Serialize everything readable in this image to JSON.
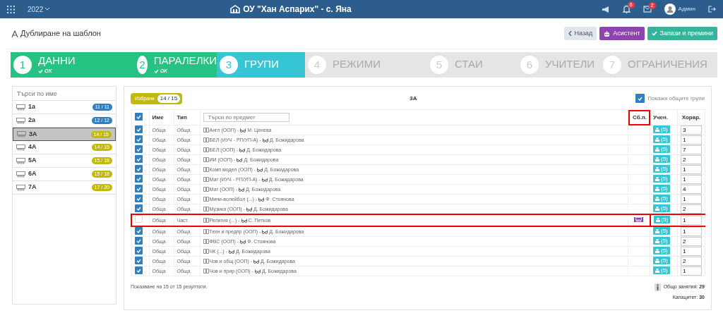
{
  "topbar": {
    "year": "2022",
    "school": "ОУ \"Хан Аспарих\" - с. Яна",
    "notifications": "6",
    "messages": "2",
    "user": "Админ"
  },
  "page": {
    "title": "Дублиране на шаблон",
    "buttons": [
      {
        "label": "Назад",
        "kind": "back"
      },
      {
        "label": "Асистент",
        "kind": "assistant"
      },
      {
        "label": "Запази и премини",
        "kind": "save"
      }
    ]
  },
  "steps": [
    {
      "number": "1",
      "label": "ДАННИ",
      "completed": true,
      "selected": false,
      "note": "OK"
    },
    {
      "number": "2",
      "label": "ПАРАЛЕЛКИ",
      "completed": true,
      "selected": false,
      "note": "OK"
    },
    {
      "number": "3",
      "label": "ГРУПИ",
      "completed": false,
      "selected": true
    },
    {
      "number": "4",
      "label": "РЕЖИМИ",
      "completed": false,
      "selected": false
    },
    {
      "number": "5",
      "label": "СТАИ",
      "completed": false,
      "selected": false
    },
    {
      "number": "6",
      "label": "УЧИТЕЛИ",
      "completed": false,
      "selected": false
    },
    {
      "number": "7",
      "label": "ОГРАНИЧЕНИЯ",
      "completed": false,
      "selected": false
    }
  ],
  "classes": {
    "placeholder": "Търси по име",
    "items": [
      {
        "name": "1а",
        "count": "11 / 11",
        "full": true,
        "selected": false
      },
      {
        "name": "2а",
        "count": "12 / 12",
        "full": true,
        "selected": false
      },
      {
        "name": "3А",
        "count": "14 / 15",
        "full": false,
        "selected": true
      },
      {
        "name": "4А",
        "count": "14 / 15",
        "full": false,
        "selected": false
      },
      {
        "name": "5А",
        "count": "15 / 18",
        "full": false,
        "selected": false
      },
      {
        "name": "6А",
        "count": "15 / 18",
        "full": false,
        "selected": false
      },
      {
        "name": "7А",
        "count": "17 / 20",
        "full": false,
        "selected": false
      }
    ]
  },
  "groups": {
    "selected_label": "Избрани",
    "selected_count": "14 / 15",
    "class_name": "3А",
    "show_common": {
      "label": "Покажи общите групи",
      "checked": true
    },
    "columns": [
      {
        "label": "Име",
        "highlighted": false
      },
      {
        "label": "Тип",
        "highlighted": false
      },
      {
        "label": "Сб.п.",
        "highlighted": true
      },
      {
        "label": "Учен.",
        "highlighted": false
      },
      {
        "label": "Хорар.",
        "highlighted": false
      }
    ],
    "all_checked": true,
    "subject_placeholder": "Търси по предмет",
    "rows": [
      {
        "checked": true,
        "name": "Обща",
        "type": "Обща",
        "subject": "Англ (ООП) -",
        "teacher": "М. Ценева",
        "combined": false,
        "students": "(5)",
        "hours": "3",
        "highlighted": false
      },
      {
        "checked": true,
        "name": "Обща",
        "type": "Обща",
        "subject": "БЕЛ (ИУЧ - РП/УП-А) -",
        "teacher": "Д. Божидарова",
        "combined": false,
        "students": "(5)",
        "hours": "1",
        "highlighted": false
      },
      {
        "checked": true,
        "name": "Обща",
        "type": "Обща",
        "subject": "БЕЛ (ООП) -",
        "teacher": "Д. Божидарова",
        "combined": false,
        "students": "(5)",
        "hours": "7",
        "highlighted": false
      },
      {
        "checked": true,
        "name": "Обща",
        "type": "Обща",
        "subject": "ИИ (ООП) -",
        "teacher": "Д. Божидарова",
        "combined": false,
        "students": "(5)",
        "hours": "2",
        "highlighted": false
      },
      {
        "checked": true,
        "name": "Обща",
        "type": "Обща",
        "subject": "Комп модел (ООП) -",
        "teacher": "Д. Божидарова",
        "combined": false,
        "students": "(5)",
        "hours": "1",
        "highlighted": false
      },
      {
        "checked": true,
        "name": "Обща",
        "type": "Обща",
        "subject": "Мат (ИУЧ - РП/УП-А) -",
        "teacher": "Д. Божидарова",
        "combined": false,
        "students": "(5)",
        "hours": "1",
        "highlighted": false
      },
      {
        "checked": true,
        "name": "Обща",
        "type": "Обща",
        "subject": "Мат (ООП) -",
        "teacher": "Д. Божидарова",
        "combined": false,
        "students": "(5)",
        "hours": "4",
        "highlighted": false
      },
      {
        "checked": true,
        "name": "Обща",
        "type": "Обща",
        "subject": "Мини-волейбол (...) -",
        "teacher": "Ф. Стоянова",
        "combined": false,
        "students": "(5)",
        "hours": "1",
        "highlighted": false
      },
      {
        "checked": true,
        "name": "Обща",
        "type": "Обща",
        "subject": "Музика (ООП) -",
        "teacher": "Д. Божидарова",
        "combined": false,
        "students": "(5)",
        "hours": "2",
        "highlighted": false
      },
      {
        "checked": false,
        "name": "Обща",
        "type": "Част.",
        "subject": "Религия (...) -",
        "teacher": "С. Петков",
        "combined": true,
        "students": "(5)",
        "hours": "1",
        "highlighted": true
      },
      {
        "checked": true,
        "name": "Обща",
        "type": "Обща",
        "subject": "Техн и предпр (ООП) -",
        "teacher": "Д. Божидарова",
        "combined": false,
        "students": "(5)",
        "hours": "1",
        "highlighted": false
      },
      {
        "checked": true,
        "name": "Обща",
        "type": "Обща",
        "subject": "ФВС (ООП) -",
        "teacher": "Ф. Стоянова",
        "combined": false,
        "students": "(5)",
        "hours": "2",
        "highlighted": false
      },
      {
        "checked": true,
        "name": "Обща",
        "type": "Обща",
        "subject": "ЧК (...) -",
        "teacher": "Д. Божидарова",
        "combined": false,
        "students": "(5)",
        "hours": "1",
        "highlighted": false
      },
      {
        "checked": true,
        "name": "Обща",
        "type": "Обща",
        "subject": "Чов и общ (ООП) -",
        "teacher": "Д. Божидарова",
        "combined": false,
        "students": "(5)",
        "hours": "2",
        "highlighted": false
      },
      {
        "checked": true,
        "name": "Обща",
        "type": "Обща",
        "subject": "Чов и прир (ООП) -",
        "teacher": "Д. Божидарова",
        "combined": false,
        "students": "(5)",
        "hours": "1",
        "highlighted": false
      }
    ],
    "summary": "Показване на 15 от 15 резултати.",
    "total_label": "Общо занятия:",
    "total": "29",
    "capacity_label": "Капацитет:",
    "capacity": "30"
  }
}
